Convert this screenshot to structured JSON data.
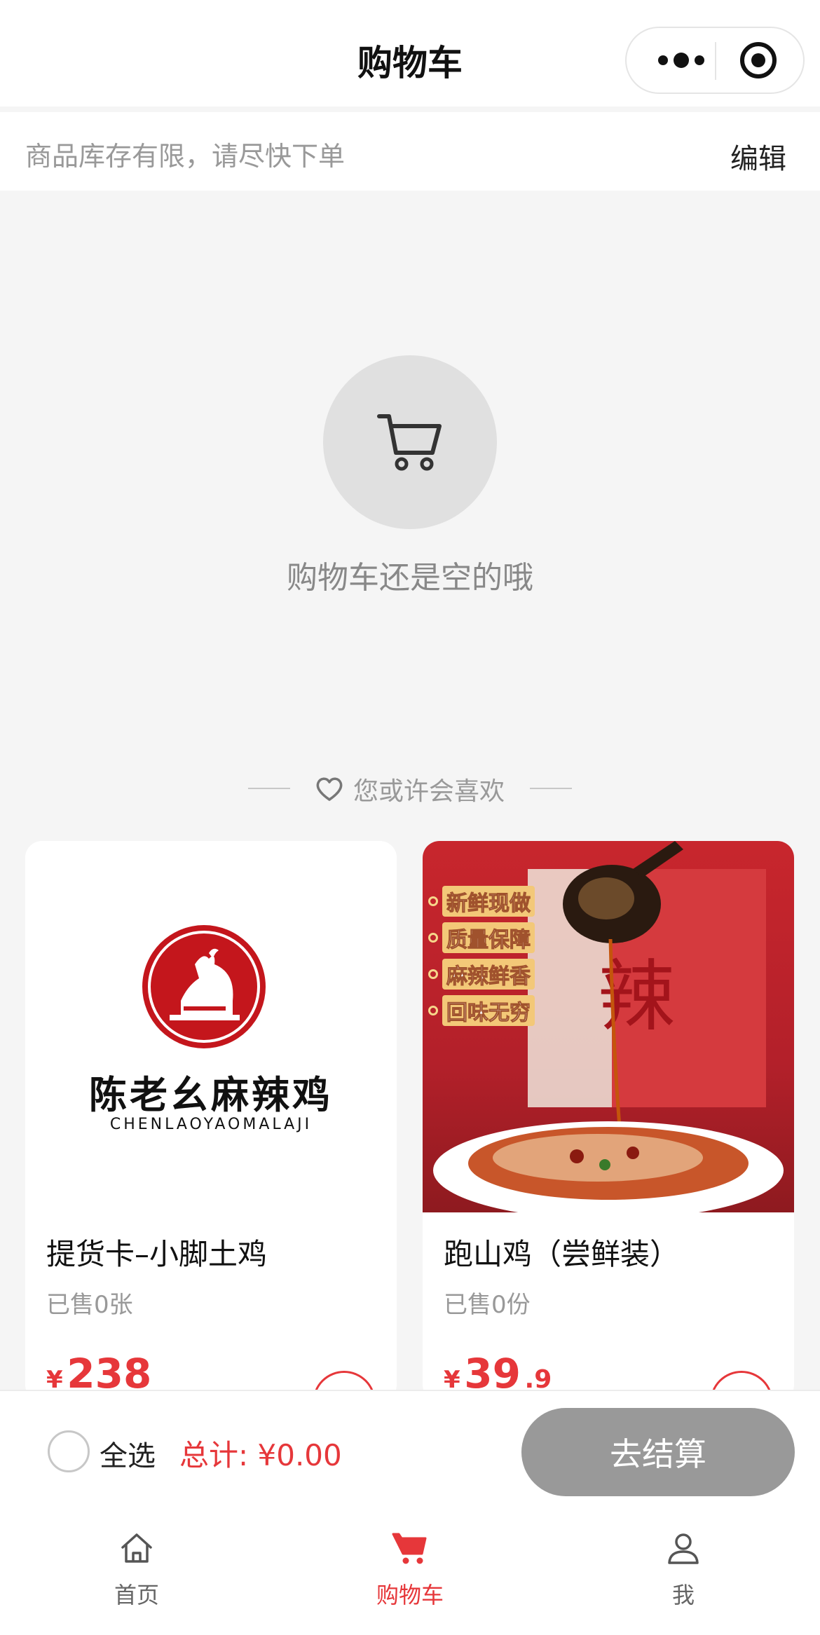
{
  "header": {
    "title": "购物车"
  },
  "notice": {
    "text": "商品库存有限，请尽快下单",
    "edit_label": "编辑"
  },
  "empty": {
    "text": "购物车还是空的哦"
  },
  "recommend": {
    "label": "您或许会喜欢"
  },
  "products": [
    {
      "name": "提货卡–小脚土鸡",
      "sold": "已售0张",
      "price_symbol": "¥",
      "price_int": "238",
      "price_dec": "",
      "logo_name_cn": "陈老幺麻辣鸡",
      "logo_name_en": "CHENLAOYAOMALAJI"
    },
    {
      "name": "跑山鸡（尝鲜装）",
      "sold": "已售0份",
      "price_symbol": "¥",
      "price_int": "39",
      "price_dec": ".9",
      "tags": [
        "新鲜现做",
        "质量保障",
        "麻辣鲜香",
        "回味无穷"
      ],
      "bag_text": "辣"
    }
  ],
  "checkout": {
    "select_all": "全选",
    "total": "总计: ¥0.00",
    "pay_label": "去结算"
  },
  "tabs": [
    {
      "label": "首页",
      "icon": "home-icon"
    },
    {
      "label": "购物车",
      "icon": "cart-icon"
    },
    {
      "label": "我",
      "icon": "user-icon"
    }
  ],
  "colors": {
    "accent": "#e6373a",
    "disabled_button": "#999999",
    "background": "#f5f5f5"
  }
}
